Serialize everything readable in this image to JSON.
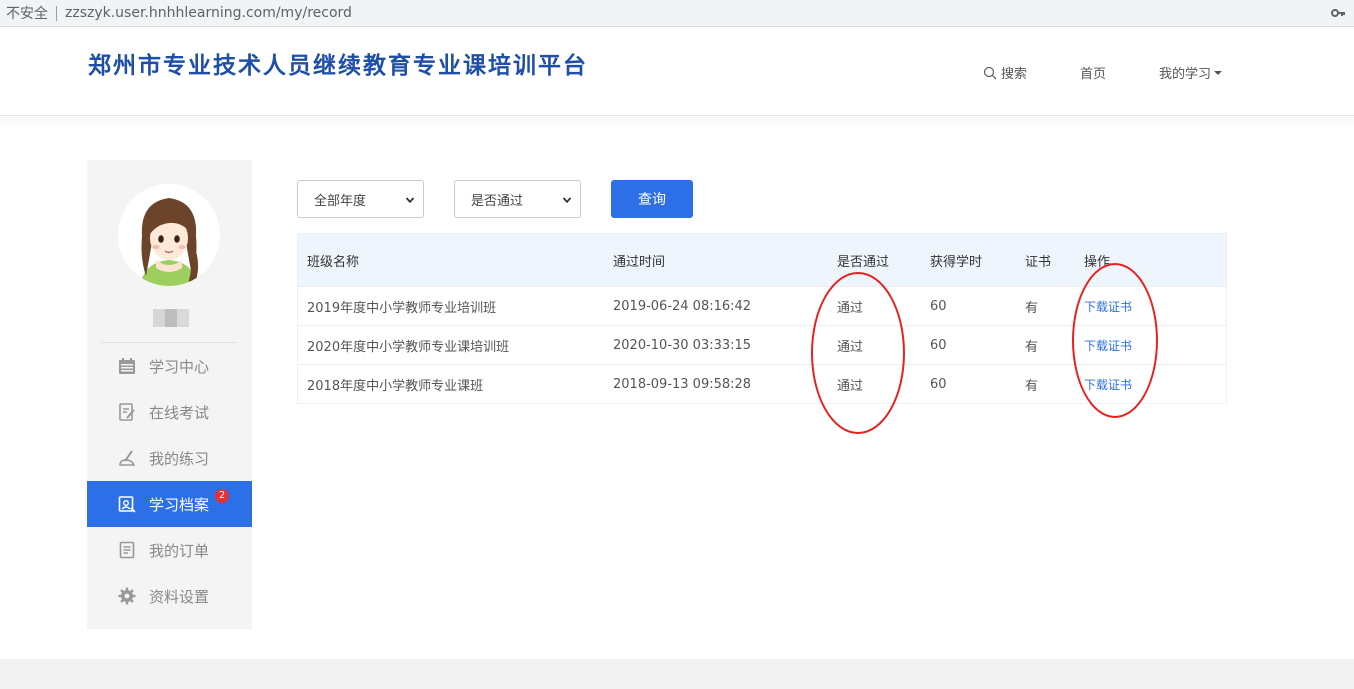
{
  "browser": {
    "security_label": "不安全",
    "url": "zzszyk.user.hnhhlearning.com/my/record"
  },
  "header": {
    "site_title": "郑州市专业技术人员继续教育专业课培训平台",
    "nav": {
      "search": "搜索",
      "home": "首页",
      "my_study": "我的学习"
    }
  },
  "sidebar": {
    "menu": [
      {
        "label": "学习中心",
        "icon": "calendar-icon"
      },
      {
        "label": "在线考试",
        "icon": "exam-icon"
      },
      {
        "label": "我的练习",
        "icon": "practice-icon"
      },
      {
        "label": "学习档案",
        "icon": "archive-icon",
        "active": true,
        "badge": "2"
      },
      {
        "label": "我的订单",
        "icon": "order-icon"
      },
      {
        "label": "资料设置",
        "icon": "gear-icon"
      }
    ]
  },
  "filters": {
    "year_select": "全部年度",
    "pass_select": "是否通过",
    "query_button": "查询"
  },
  "table": {
    "headers": [
      "班级名称",
      "通过时间",
      "是否通过",
      "获得学时",
      "证书",
      "操作"
    ],
    "rows": [
      [
        "2019年度中小学教师专业培训班",
        "2019-06-24 08:16:42",
        "通过",
        "60",
        "有",
        "下载证书"
      ],
      [
        "2020年度中小学教师专业课培训班",
        "2020-10-30 03:33:15",
        "通过",
        "60",
        "有",
        "下载证书"
      ],
      [
        "2018年度中小学教师专业课班",
        "2018-09-13 09:58:28",
        "通过",
        "60",
        "有",
        "下载证书"
      ]
    ]
  },
  "colors": {
    "accent": "#2d6fe6",
    "title": "#1f4fa8",
    "annotation": "#e8211f"
  }
}
